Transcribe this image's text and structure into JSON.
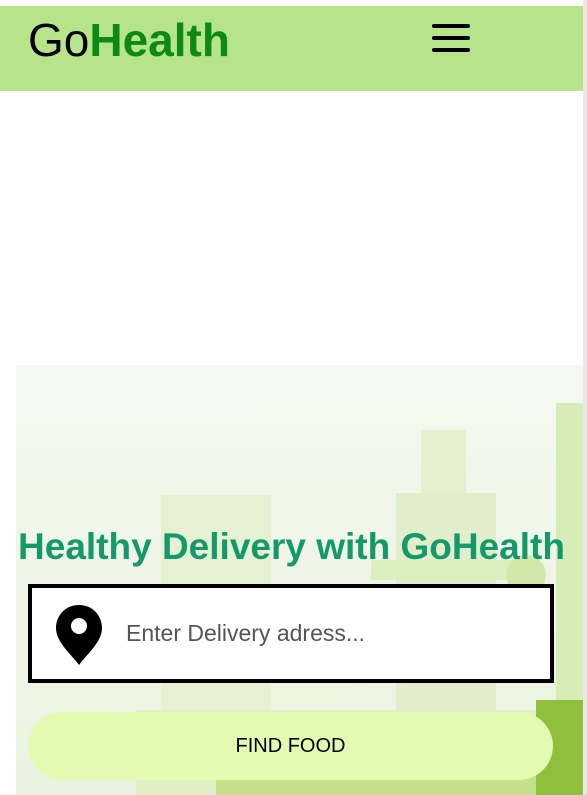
{
  "header": {
    "logo_part1": "Go",
    "logo_part2": "Health",
    "menu_icon": "hamburger-menu-icon",
    "background_color": "#b7e48a",
    "logo_accent_color": "#0c8a12"
  },
  "hero": {
    "headline": "Healthy Delivery with GoHealth",
    "headline_color": "#149a6a"
  },
  "address": {
    "placeholder": "Enter Delivery adress...",
    "value": "",
    "icon": "location-pin-icon"
  },
  "cta": {
    "label": "FIND FOOD",
    "background_color": "#e2fbb0"
  }
}
